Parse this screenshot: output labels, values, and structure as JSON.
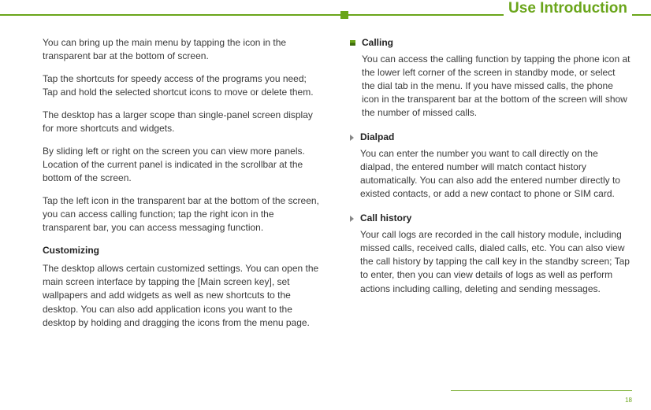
{
  "header": {
    "title": "Use Introduction"
  },
  "left": {
    "p1": "You can bring up the main menu by tapping the icon in the transparent bar at the bottom of screen.",
    "p2": "Tap the shortcuts for speedy access of the programs you need; Tap and hold the selected shortcut icons to move or delete them.",
    "p3": "The desktop has a larger scope than single-panel screen display for more shortcuts and widgets.",
    "p4": "By sliding left or right on the screen you can view more panels. Location of the current panel is indicated in the scrollbar at the bottom of the screen.",
    "p5": "Tap the left icon in the transparent bar at the bottom of the screen, you can access calling function; tap the right icon in the transparent bar, you can access messaging function.",
    "customizing_title": "Customizing",
    "customizing_body": "The desktop allows certain customized settings. You can open the main screen interface by tapping the [Main screen key], set wallpapers and add widgets as well as new shortcuts to the desktop. You can also add application icons you want to the desktop by holding and dragging the icons from the menu page."
  },
  "right": {
    "items": [
      {
        "title": "Calling",
        "body": "You can access the calling function by tapping the phone icon at the lower left corner of the screen in standby mode, or select the dial tab in the menu. If you have missed calls, the phone icon in the transparent bar at the bottom of the screen will show the number of missed calls."
      },
      {
        "title": "Dialpad",
        "body": "You can enter the number you want to call directly on the dialpad, the entered number will match contact history automatically. You can also add the entered number directly to existed contacts, or add a new contact to phone or SIM card."
      },
      {
        "title": "Call history",
        "body": "Your call logs are recorded in the call history module, including missed calls, received calls, dialed calls, etc. You can also view the call history by tapping the call key in the standby screen; Tap to enter, then you can view details of logs as well as perform actions including calling, deleting and sending messages."
      }
    ]
  },
  "page_number": "18"
}
